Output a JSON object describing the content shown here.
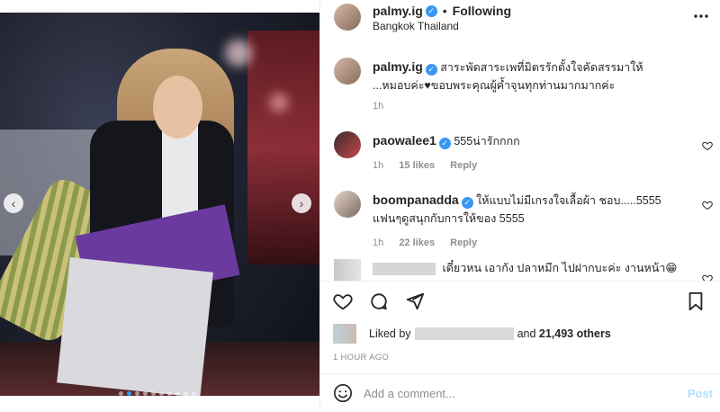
{
  "post": {
    "username": "palmy.ig",
    "following_label": "Following",
    "location": "Bangkok Thailand",
    "more_icon": "more-horizontal-icon",
    "carousel": {
      "slide_count": 10,
      "active_index": 1
    }
  },
  "caption": {
    "username": "palmy.ig",
    "text": "สาระพัดสาระเพที่มิตรรักตั้งใจคัดสรรมาให้ ...หมอบค่ะ♥ขอบพระคุณผู้ค้ำจุนทุกท่านมากมากค่ะ",
    "time": "1h"
  },
  "comments": [
    {
      "username": "paowalee1",
      "text": "555น่ารักกกก",
      "time": "1h",
      "likes": "15 likes",
      "reply": "Reply"
    },
    {
      "username": "boompanadda",
      "text": "ให้แบบไม่มีเกรงใจเลื้อผ้า ชอบ.....5555 แฟนๆดูสนุกกับการให้ของ 5555",
      "time": "1h",
      "likes": "22 likes",
      "reply": "Reply"
    },
    {
      "username": "",
      "text": "เดี๋ยวหน เอากัง ปลาหมึก ไปฝากบะค่ะ งานหน้า😁😁😁",
      "time": ""
    }
  ],
  "likes": {
    "prefix": "Liked by",
    "connector": "and",
    "others": "21,493 others"
  },
  "timestamp": "1 HOUR AGO",
  "comment_box": {
    "placeholder": "Add a comment...",
    "post_label": "Post"
  },
  "colors": {
    "verified": "#3897f0",
    "post_disabled": "#b2dffc",
    "meta": "#8e8e8e"
  }
}
